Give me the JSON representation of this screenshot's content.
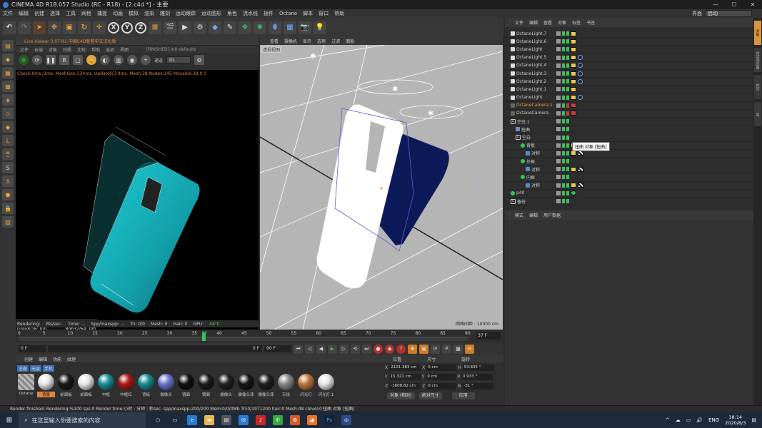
{
  "window": {
    "title": "CINEMA 4D R18.057 Studio (RC - R18) - [2.c4d *] - 主要",
    "min": "—",
    "max": "☐",
    "close": "✕"
  },
  "menu": {
    "items": [
      "文件",
      "编辑",
      "创建",
      "选择",
      "工具",
      "网格",
      "捕捉",
      "动画",
      "模拟",
      "渲染",
      "雕刻",
      "运动跟踪",
      "运动图形",
      "角色",
      "流水线",
      "插件",
      "Octane",
      "脚本",
      "窗口",
      "帮助"
    ],
    "layout_label": "界面",
    "layout_value": "启动"
  },
  "toolbar": {
    "axis_x": "X",
    "axis_y": "Y",
    "axis_z": "Z"
  },
  "live_viewer": {
    "title": "Live Viewer 3.07-R1 中国C4D联盟中文汉化版",
    "menu": [
      "文件",
      "云端",
      "对象",
      "材质",
      "比较",
      "帮助",
      "选项",
      "界面"
    ],
    "status": "[FINISHED] Init defaults",
    "channel_label": "通道",
    "channel_value": "DL",
    "info_line": "Check:0ms./1ms. MeshGen:334ms. Update[C]:0ms. Mesh:38 Nodes:145 Movable:38  0 0",
    "stats": [
      {
        "label": "Out-of-core used/max:",
        "value": "0Kb/4Gb"
      },
      {
        "label": "Grey8/16: 0/0",
        "value": "Rgb32/64: 0/0"
      },
      {
        "label": "Used/free/total vram:",
        "value": "0Kb/0Kb/0Kb"
      }
    ],
    "render_bar": {
      "rendering": "Rendering:",
      "ms": "Ms/sec:",
      "time": "Time: ...",
      "spp": "Spp/maxspp: ...",
      "tri": "Tri: 0/0",
      "mesh": "Mesh: 0",
      "hair": "Hair: 0",
      "gpu": "GPU:",
      "temp": "44°C"
    }
  },
  "viewport": {
    "menu": [
      "查看",
      "摄像机",
      "显示",
      "选项",
      "过滤",
      "面板"
    ],
    "camera_tag": "透视视图",
    "grid": "网格间距 : 10000 cm"
  },
  "timeline": {
    "ticks": [
      "0",
      "5",
      "10",
      "15",
      "20",
      "25",
      "30",
      "35",
      "37",
      "40",
      "45",
      "50",
      "55",
      "60",
      "65",
      "70",
      "75",
      "80",
      "85",
      "90"
    ],
    "current_frame": 37,
    "frame_field": "37 F"
  },
  "playback": {
    "start": "0 F",
    "min": "0 F",
    "end": "90 F",
    "max": "90 F"
  },
  "materials": {
    "tabs": [
      "创建",
      "编辑",
      "功能",
      "纹理"
    ],
    "filters": [
      {
        "label": "全部",
        "on": true
      },
      {
        "label": "无层",
        "on": true
      },
      {
        "label": "手机",
        "on": true
      }
    ],
    "items": [
      {
        "label": "Octane",
        "color": "#9a9a9a"
      },
      {
        "label": "背景",
        "color": "#e7e7e7",
        "selected": true
      },
      {
        "label": "前面板",
        "color": "#1a1a1a"
      },
      {
        "label": "前面板",
        "color": "#e8e8e8"
      },
      {
        "label": "中框",
        "color": "#1a8f95"
      },
      {
        "label": "中框红",
        "color": "#b01a1a"
      },
      {
        "label": "背板",
        "color": "#1a8f95"
      },
      {
        "label": "摄像头",
        "color": "#6b78d0"
      },
      {
        "label": "镜面",
        "color": "#111111"
      },
      {
        "label": "镜面",
        "color": "#1d1d1d"
      },
      {
        "label": "摄像头",
        "color": "#222222"
      },
      {
        "label": "摄像头漆",
        "color": "#181818"
      },
      {
        "label": "摄像头漆",
        "color": "#202020"
      },
      {
        "label": "天线",
        "color": "#8a8a8a"
      },
      {
        "label": "闪光灯",
        "color": "#c07a3a"
      },
      {
        "label": "闪光灯.1",
        "color": "#e8e8e8"
      }
    ]
  },
  "coords": {
    "headers": [
      "位置",
      "尺寸",
      "旋转"
    ],
    "rows": [
      {
        "axis": "X",
        "pos": "2101.383 cm",
        "size": "0 cm",
        "rlabel": "H",
        "rot": "53.835 °"
      },
      {
        "axis": "Y",
        "pos": "15.321 cm",
        "size": "0 cm",
        "rlabel": "P",
        "rot": "0.933 °"
      },
      {
        "axis": "Z",
        "pos": "-1608.82 cm",
        "size": "0 cm",
        "rlabel": "B",
        "rot": "-31 °"
      }
    ],
    "mode": "对象 (相对)",
    "size_mode": "绝对尺寸",
    "apply": "应用"
  },
  "objects": {
    "menu": [
      "文件",
      "编辑",
      "查看",
      "对象",
      "标签",
      "书签"
    ],
    "rows": [
      {
        "name": "OctaneLight.7",
        "indent": 0,
        "icon": "light",
        "tags": [
          "light"
        ]
      },
      {
        "name": "OctaneLight.6",
        "indent": 0,
        "icon": "light",
        "tags": [
          "light"
        ]
      },
      {
        "name": "OctaneLight",
        "indent": 0,
        "icon": "light",
        "tags": [
          "light"
        ]
      },
      {
        "name": "OctaneLight.5",
        "indent": 0,
        "icon": "light",
        "tags": [
          "light",
          "ring"
        ]
      },
      {
        "name": "OctaneLight.4",
        "indent": 0,
        "icon": "light",
        "tags": [
          "light",
          "ring"
        ]
      },
      {
        "name": "OctaneLight.3",
        "indent": 0,
        "icon": "light",
        "tags": [
          "light",
          "ring"
        ]
      },
      {
        "name": "OctaneLight.2",
        "indent": 0,
        "icon": "light",
        "tags": [
          "light",
          "ring"
        ]
      },
      {
        "name": "OctaneLight.1",
        "indent": 0,
        "icon": "light",
        "tags": [
          "light"
        ]
      },
      {
        "name": "OctaneLight",
        "indent": 0,
        "icon": "light",
        "tags": [
          "light",
          "ring"
        ]
      },
      {
        "name": "OctaneCamera.1",
        "indent": 0,
        "icon": "cam",
        "tags": [
          "cam"
        ],
        "highlight": true
      },
      {
        "name": "OctaneCamera",
        "indent": 0,
        "icon": "cam",
        "tags": [
          "cam"
        ]
      },
      {
        "name": "空白.1",
        "indent": 0,
        "icon": "null",
        "tags": []
      },
      {
        "name": "扭曲",
        "indent": 1,
        "icon": "blue",
        "tags": []
      },
      {
        "name": "空白",
        "indent": 1,
        "icon": "null",
        "tags": []
      },
      {
        "name": "背板",
        "indent": 2,
        "icon": "green",
        "tags": [
          "light",
          "chk"
        ]
      },
      {
        "name": "对称",
        "indent": 3,
        "icon": "sym",
        "tags": [
          "light",
          "chk"
        ]
      },
      {
        "name": "外框",
        "indent": 2,
        "icon": "green",
        "tags": []
      },
      {
        "name": "对称",
        "indent": 3,
        "icon": "sym",
        "tags": [
          "light",
          "chk"
        ]
      },
      {
        "name": "内框",
        "indent": 2,
        "icon": "green",
        "tags": []
      },
      {
        "name": "对称",
        "indent": 3,
        "icon": "sym",
        "tags": [
          "light",
          "chk"
        ]
      },
      {
        "name": "p40",
        "indent": 0,
        "icon": "green",
        "tags": [
          "green"
        ]
      },
      {
        "name": "备份",
        "indent": 0,
        "icon": "null",
        "tags": []
      }
    ],
    "tooltip": "扭曲 对象 [扭曲]"
  },
  "attributes": {
    "menu": [
      "模式",
      "编辑",
      "用户数据"
    ]
  },
  "right_tabs": [
    "对象",
    "内容浏览器",
    "构造",
    "层"
  ],
  "status": "Render finished: Rendering:%100 sps:0 Render time:小时 : 分钟 : 秒sec. spp/maxspp:200/200 Mem:0/0/0Mb Tri:0/1971200 hair:0 Mesh:48 clevel:0",
  "status_right": "扭曲 对象 [扭曲]",
  "taskbar": {
    "search_placeholder": "在这里输入你要搜索的内容",
    "lang": "ENG",
    "time": "18:14",
    "date": "2020/8/3"
  }
}
